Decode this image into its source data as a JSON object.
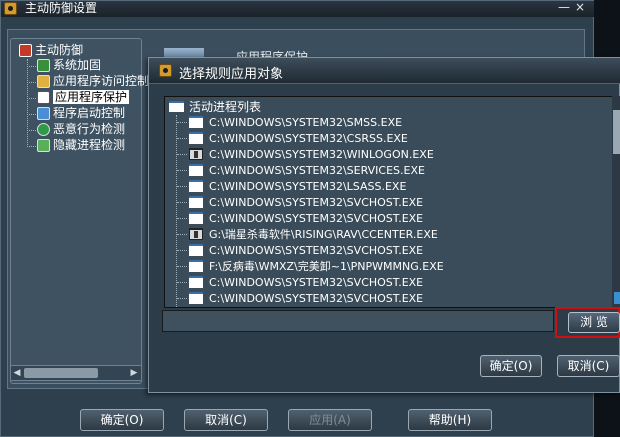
{
  "main_window": {
    "title": "主动防御设置",
    "minimize": "—",
    "close": "×"
  },
  "tree": {
    "root": "主动防御",
    "items": [
      {
        "label": "系统加固",
        "icon": "shield-gear-icon",
        "selected": false
      },
      {
        "label": "应用程序访问控制",
        "icon": "folder-key-icon",
        "selected": false
      },
      {
        "label": "应用程序保护",
        "icon": "app-protect-icon",
        "selected": true
      },
      {
        "label": "程序启动控制",
        "icon": "program-launch-icon",
        "selected": false
      },
      {
        "label": "恶意行为检测",
        "icon": "globe-check-icon",
        "selected": false
      },
      {
        "label": "隐藏进程检测",
        "icon": "hidden-process-icon",
        "selected": false
      }
    ]
  },
  "background_header": "应用程序保护",
  "bottom_buttons": {
    "ok": "确定(O)",
    "cancel": "取消(C)",
    "apply": "应用(A)",
    "help": "帮助(H)"
  },
  "dialog": {
    "title": "选择规则应用对象",
    "list_root": "活动进程列表",
    "processes": [
      {
        "path": "C:\\WINDOWS\\SYSTEM32\\SMSS.EXE",
        "icon": "window-icon"
      },
      {
        "path": "C:\\WINDOWS\\SYSTEM32\\CSRSS.EXE",
        "icon": "window-icon"
      },
      {
        "path": "C:\\WINDOWS\\SYSTEM32\\WINLOGON.EXE",
        "icon": "winlogon-icon"
      },
      {
        "path": "C:\\WINDOWS\\SYSTEM32\\SERVICES.EXE",
        "icon": "window-icon"
      },
      {
        "path": "C:\\WINDOWS\\SYSTEM32\\LSASS.EXE",
        "icon": "window-icon"
      },
      {
        "path": "C:\\WINDOWS\\SYSTEM32\\SVCHOST.EXE",
        "icon": "window-icon"
      },
      {
        "path": "C:\\WINDOWS\\SYSTEM32\\SVCHOST.EXE",
        "icon": "window-icon"
      },
      {
        "path": "G:\\瑞星杀毒软件\\RISING\\RAV\\CCENTER.EXE",
        "icon": "rising-icon"
      },
      {
        "path": "C:\\WINDOWS\\SYSTEM32\\SVCHOST.EXE",
        "icon": "window-icon"
      },
      {
        "path": "F:\\反病毒\\WMXZ\\完美卸~1\\PNPWMMNG.EXE",
        "icon": "window-icon"
      },
      {
        "path": "C:\\WINDOWS\\SYSTEM32\\SVCHOST.EXE",
        "icon": "window-icon"
      },
      {
        "path": "C:\\WINDOWS\\SYSTEM32\\SVCHOST.EXE",
        "icon": "window-icon"
      }
    ],
    "path_value": "",
    "browse": "浏 览",
    "ok": "确定(O)",
    "cancel": "取消(C)"
  },
  "colors": {
    "panel": "#3b4e5e",
    "dialog": "#2c3c49",
    "highlight_frame": "#d01010"
  }
}
